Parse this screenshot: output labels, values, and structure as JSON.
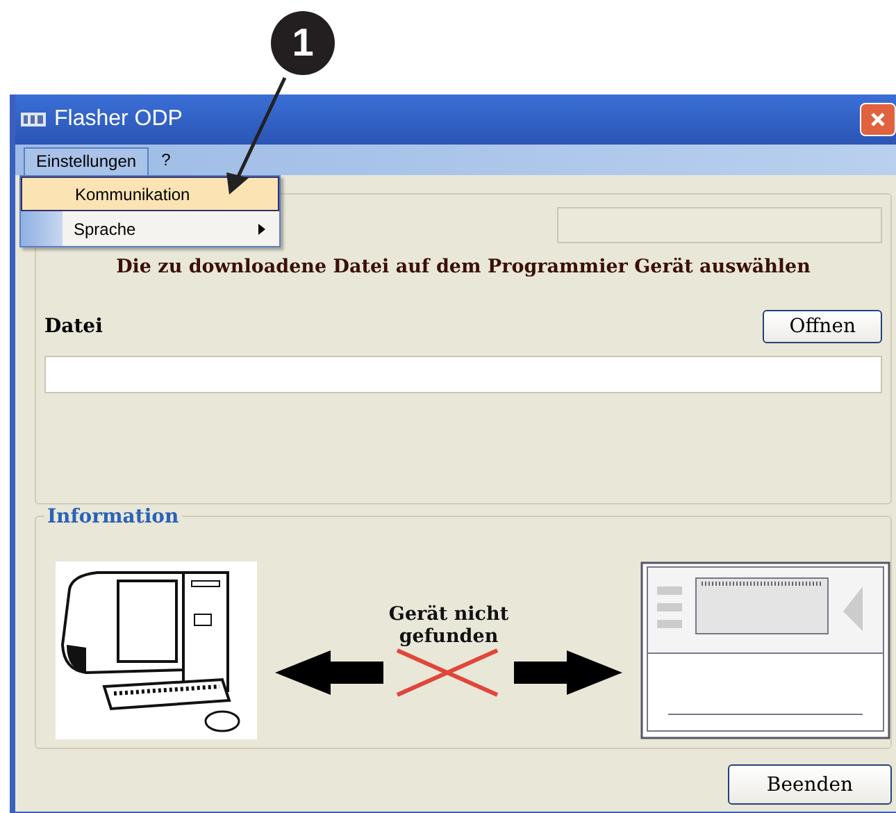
{
  "callout": {
    "number": "1"
  },
  "window": {
    "title": "Flasher ODP"
  },
  "menubar": [
    {
      "label": "Einstellungen",
      "open": true
    },
    {
      "label": "?",
      "open": false
    }
  ],
  "menu": [
    {
      "label": "Kommunikation",
      "kind": "command",
      "selected": true
    },
    {
      "label": "Sprache",
      "kind": "submenu",
      "selected": false
    }
  ],
  "instruction": "Die zu downloadene Datei auf dem Programmier Gerät auswählen",
  "file": {
    "label": "Datei",
    "button": "Offnen"
  },
  "information": {
    "title": "Information",
    "status": "Gerät nicht gefunden",
    "connected": false
  },
  "buttons": [
    "Beenden"
  ]
}
